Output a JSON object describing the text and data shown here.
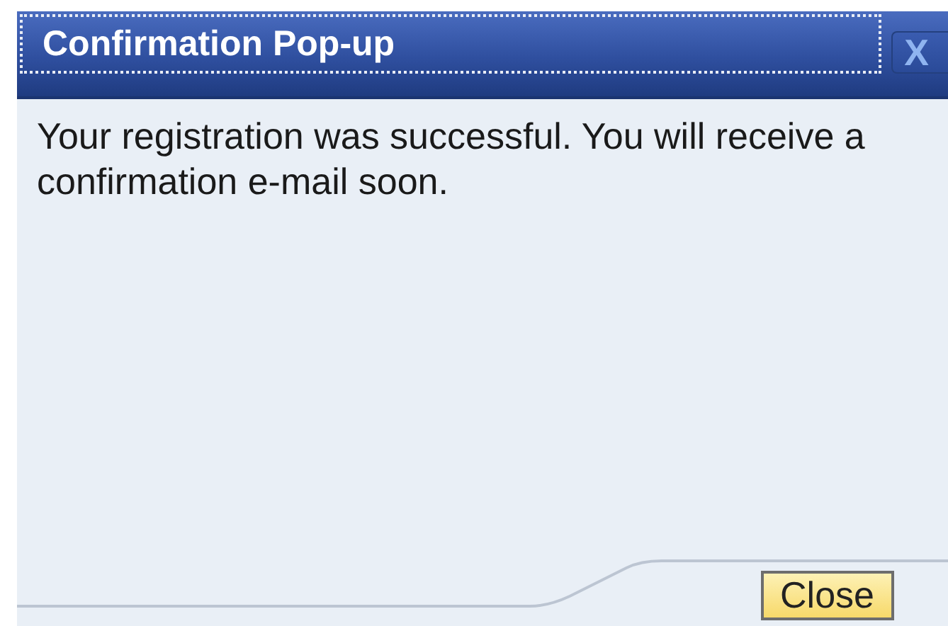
{
  "dialog": {
    "title": "Confirmation Pop-up",
    "close_icon": "X",
    "message": "Your registration was successful. You will receive a confirmation e-mail soon.",
    "buttons": [
      {
        "label": "Close"
      }
    ]
  }
}
